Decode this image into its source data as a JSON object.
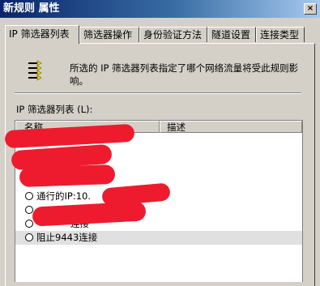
{
  "window": {
    "title": "新规则 属性",
    "close_glyph": "×"
  },
  "tabs": [
    {
      "label": "IP 筛选器列表",
      "active": true
    },
    {
      "label": "筛选器操作",
      "active": false
    },
    {
      "label": "身份验证方法",
      "active": false
    },
    {
      "label": "隧道设置",
      "active": false
    },
    {
      "label": "连接类型",
      "active": false
    }
  ],
  "description": "所选的 IP 筛选器列表指定了哪个网络流量将受此规则影响。",
  "list": {
    "label": "IP 筛选器列表 (L):",
    "columns": {
      "name": "名称",
      "desc": "描述"
    },
    "rows": [
      {
        "text": "",
        "selected": false
      },
      {
        "text": "",
        "selected": false
      },
      {
        "text": "",
        "selected": false
      },
      {
        "text": "",
        "selected": false
      },
      {
        "text": "通行的IP:10.",
        "selected": false
      },
      {
        "text": "",
        "selected": false
      },
      {
        "text": "连接",
        "selected": false
      },
      {
        "text": "阻止9443连接",
        "selected": true
      }
    ]
  },
  "colors": {
    "redaction": "#ee1b2e",
    "title_bar": "#0a246a"
  }
}
